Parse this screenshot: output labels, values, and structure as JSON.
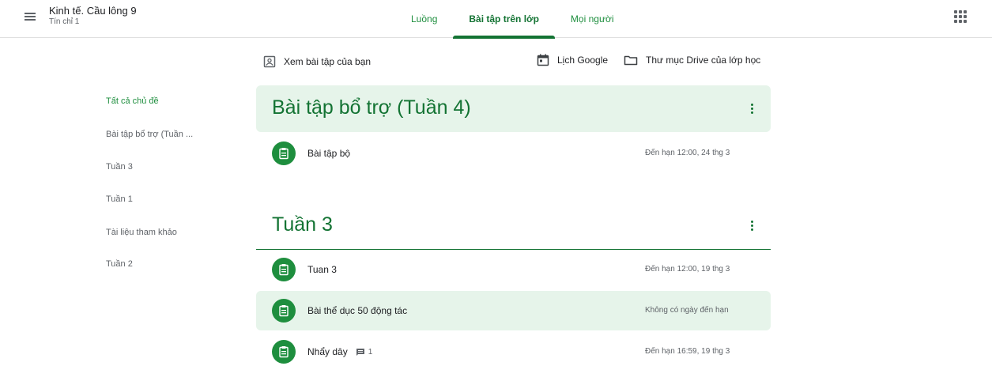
{
  "header": {
    "class_name": "Kinh tế. Cầu lông 9",
    "section": "Tín chỉ 1",
    "tabs": [
      {
        "label": "Luồng",
        "active": false
      },
      {
        "label": "Bài tập trên lớp",
        "active": true
      },
      {
        "label": "Mọi người",
        "active": false
      }
    ]
  },
  "toolbar": {
    "view_own_work": "Xem bài tập của bạn",
    "google_calendar": "Lịch Google",
    "drive_folder": "Thư mục Drive của lớp học"
  },
  "sidebar": {
    "items": [
      {
        "label": "Tất cả chủ đề",
        "active": true
      },
      {
        "label": "Bài tập bổ trợ (Tuần ...",
        "active": false
      },
      {
        "label": "Tuần 3",
        "active": false
      },
      {
        "label": "Tuần 1",
        "active": false
      },
      {
        "label": "Tài liệu tham khảo",
        "active": false
      },
      {
        "label": "Tuần 2",
        "active": false
      }
    ]
  },
  "topics": [
    {
      "title": "Bài tập bổ trợ (Tuần 4)",
      "items": [
        {
          "title": "Bài tập bộ",
          "due": "Đến hạn 12:00, 24 thg 3"
        }
      ]
    },
    {
      "title": "Tuần 3",
      "items": [
        {
          "title": "Tuan 3",
          "due": "Đến hạn 12:00, 19 thg 3"
        },
        {
          "title": "Bài thể dục 50 động tác",
          "due": "Không có ngày đến hạn"
        },
        {
          "title": "Nhẩy dây",
          "due": "Đến hạn 16:59, 19 thg 3",
          "comments": "1"
        }
      ]
    }
  ],
  "colors": {
    "accent": "#137333",
    "accent_light": "#e6f4ea",
    "icon_bg": "#1e8e3e"
  },
  "icons": {
    "menu": "hamburger-menu-icon",
    "apps": "apps-grid-icon",
    "assignment": "assignment-icon",
    "calendar": "calendar-icon",
    "folder": "folder-icon",
    "own_work": "account-box-icon",
    "comment": "comment-icon"
  }
}
